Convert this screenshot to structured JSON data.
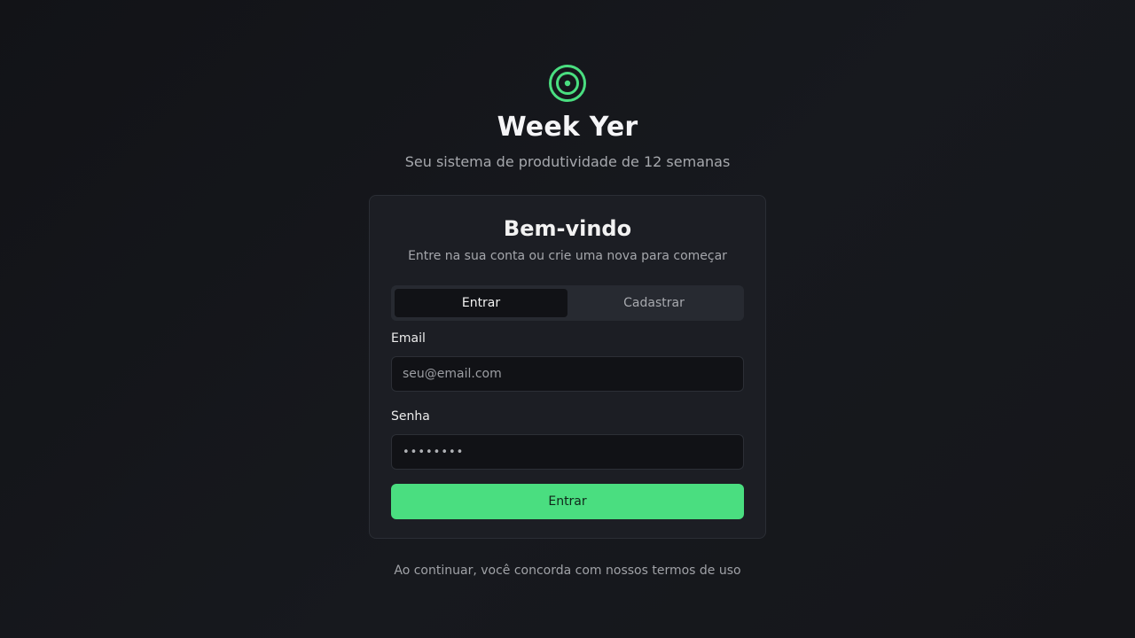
{
  "brand": {
    "name": "Week Yer",
    "tagline": "Seu sistema de produtividade de 12 semanas",
    "icon": "target-icon",
    "accent_color": "#4ade80"
  },
  "card": {
    "title": "Bem-vindo",
    "subtitle": "Entre na sua conta ou crie uma nova para começar"
  },
  "tabs": {
    "login": "Entrar",
    "signup": "Cadastrar",
    "active": "login"
  },
  "form": {
    "email_label": "Email",
    "email_placeholder": "seu@email.com",
    "password_label": "Senha",
    "password_value": "••••••••",
    "submit_label": "Entrar"
  },
  "footer": {
    "note": "Ao continuar, você concorda com nossos termos de uso"
  }
}
